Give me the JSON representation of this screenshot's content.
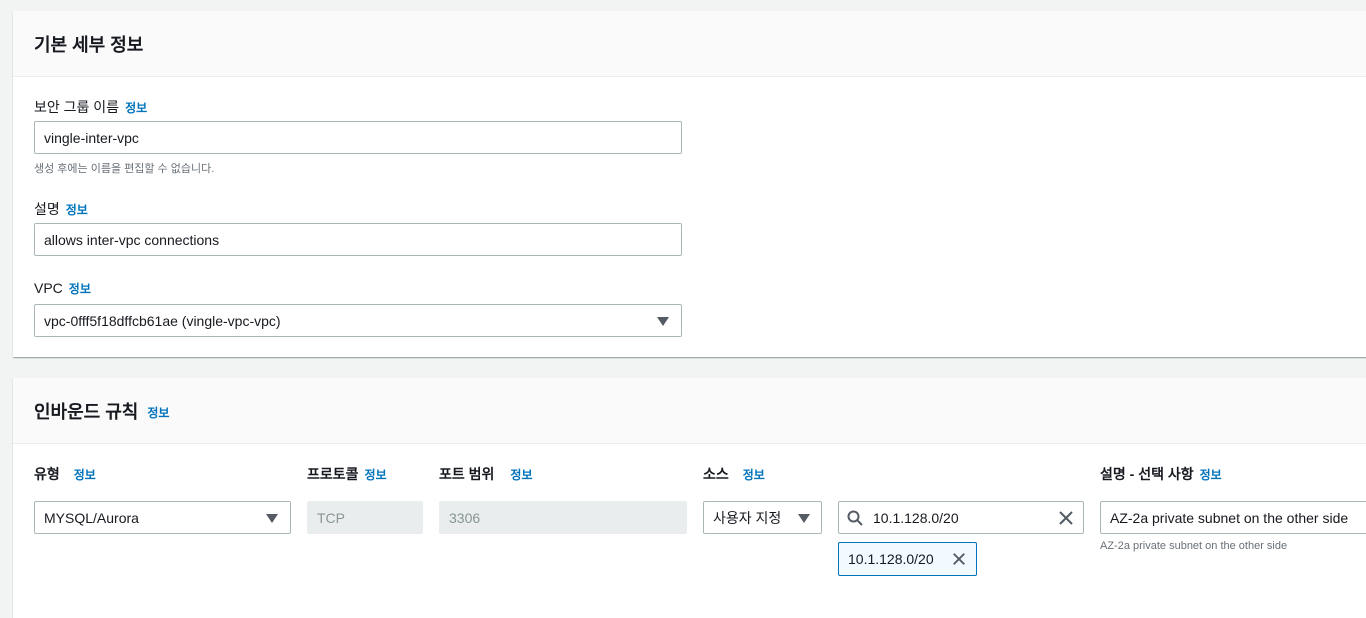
{
  "basic": {
    "title": "기본 세부 정보",
    "name_label": "보안 그룹 이름",
    "name_info": "정보",
    "name_value": "vingle-inter-vpc",
    "name_hint": "생성 후에는 이름을 편집할 수 없습니다.",
    "desc_label": "설명",
    "desc_info": "정보",
    "desc_value": "allows inter-vpc connections",
    "vpc_label": "VPC",
    "vpc_info": "정보",
    "vpc_value": "vpc-0fff5f18dffcb61ae (vingle-vpc-vpc)"
  },
  "inbound": {
    "title": "인바운드 규칙",
    "title_info": "정보",
    "columns": {
      "type": "유형",
      "protocol": "프로토콜",
      "port": "포트 범위",
      "source": "소스",
      "description": "설명 - 선택 사항",
      "info": "정보"
    },
    "row": {
      "type_value": "MYSQL/Aurora",
      "protocol_value": "TCP",
      "port_value": "3306",
      "source_mode": "사용자 지정",
      "source_search": "10.1.128.0/20",
      "source_token": "10.1.128.0/20",
      "description_value": "AZ-2a private subnet on the other side",
      "description_hint": "AZ-2a private subnet on the other side"
    }
  },
  "icons": [
    "chevron-down-icon",
    "search-icon",
    "close-icon"
  ],
  "colors": {
    "link": "#0073bb",
    "border": "#aab7b8",
    "background": "#f2f3f3"
  }
}
